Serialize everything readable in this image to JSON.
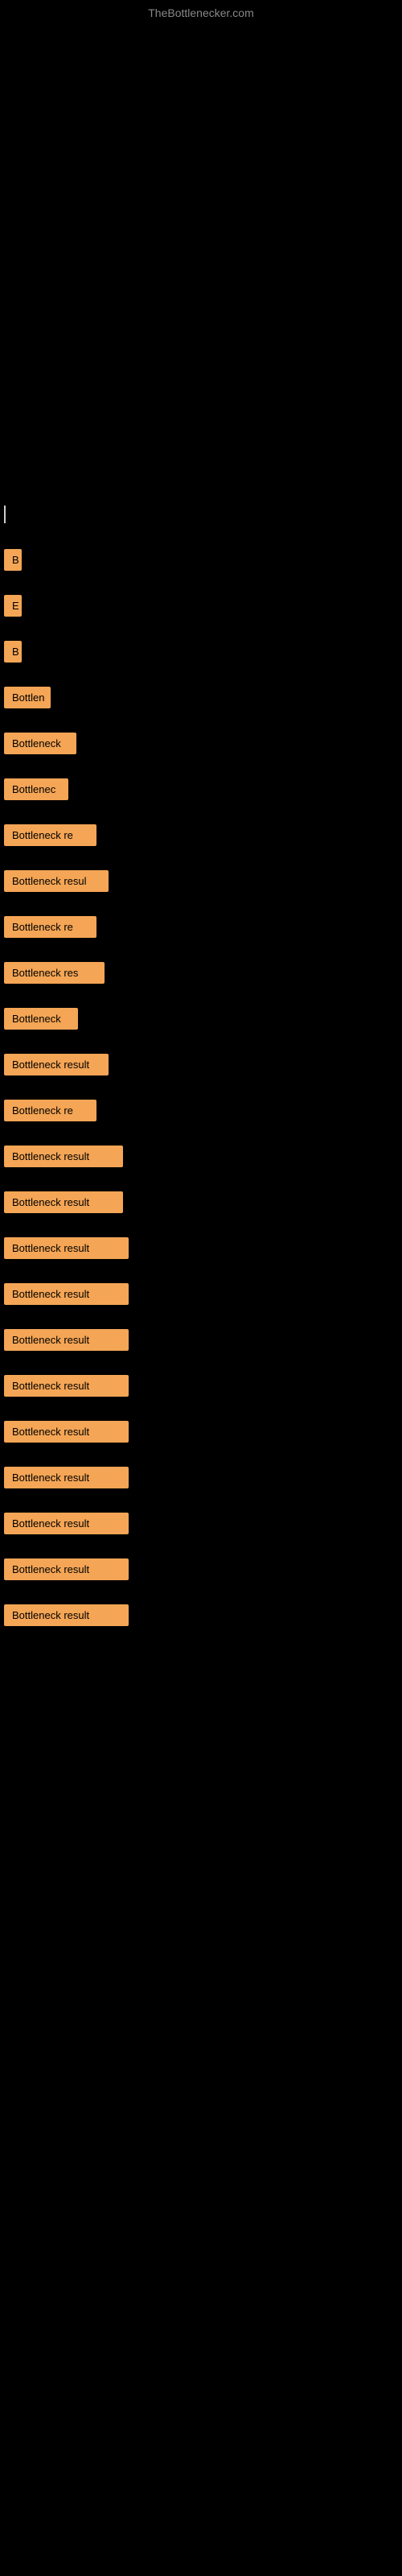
{
  "site": {
    "title": "TheBottlenecker.com"
  },
  "results": [
    {
      "id": 1,
      "label": "B",
      "width_class": "w-tiny1"
    },
    {
      "id": 2,
      "label": "E",
      "width_class": "w-tiny2"
    },
    {
      "id": 3,
      "label": "B",
      "width_class": "w-tiny3"
    },
    {
      "id": 4,
      "label": "Bottlen",
      "width_class": "w-sm1"
    },
    {
      "id": 5,
      "label": "Bottleneck",
      "width_class": "w-sm2"
    },
    {
      "id": 6,
      "label": "Bottlenec",
      "width_class": "w-sm3"
    },
    {
      "id": 7,
      "label": "Bottleneck re",
      "width_class": "w-md1"
    },
    {
      "id": 8,
      "label": "Bottleneck resul",
      "width_class": "w-md2"
    },
    {
      "id": 9,
      "label": "Bottleneck re",
      "width_class": "w-md3"
    },
    {
      "id": 10,
      "label": "Bottleneck res",
      "width_class": "w-md4"
    },
    {
      "id": 11,
      "label": "Bottleneck",
      "width_class": "w-md5"
    },
    {
      "id": 12,
      "label": "Bottleneck result",
      "width_class": "w-md6"
    },
    {
      "id": 13,
      "label": "Bottleneck re",
      "width_class": "w-md7"
    },
    {
      "id": 14,
      "label": "Bottleneck result",
      "width_class": "w-lg1"
    },
    {
      "id": 15,
      "label": "Bottleneck result",
      "width_class": "w-lg2"
    },
    {
      "id": 16,
      "label": "Bottleneck result",
      "width_class": "w-lg3"
    },
    {
      "id": 17,
      "label": "Bottleneck result",
      "width_class": "w-lg4"
    },
    {
      "id": 18,
      "label": "Bottleneck result",
      "width_class": "w-lg5"
    },
    {
      "id": 19,
      "label": "Bottleneck result",
      "width_class": "w-lg6"
    },
    {
      "id": 20,
      "label": "Bottleneck result",
      "width_class": "w-xl1"
    },
    {
      "id": 21,
      "label": "Bottleneck result",
      "width_class": "w-xl2"
    },
    {
      "id": 22,
      "label": "Bottleneck result",
      "width_class": "w-xl3"
    },
    {
      "id": 23,
      "label": "Bottleneck result",
      "width_class": "w-xl4"
    },
    {
      "id": 24,
      "label": "Bottleneck result",
      "width_class": "w-xl5"
    }
  ]
}
